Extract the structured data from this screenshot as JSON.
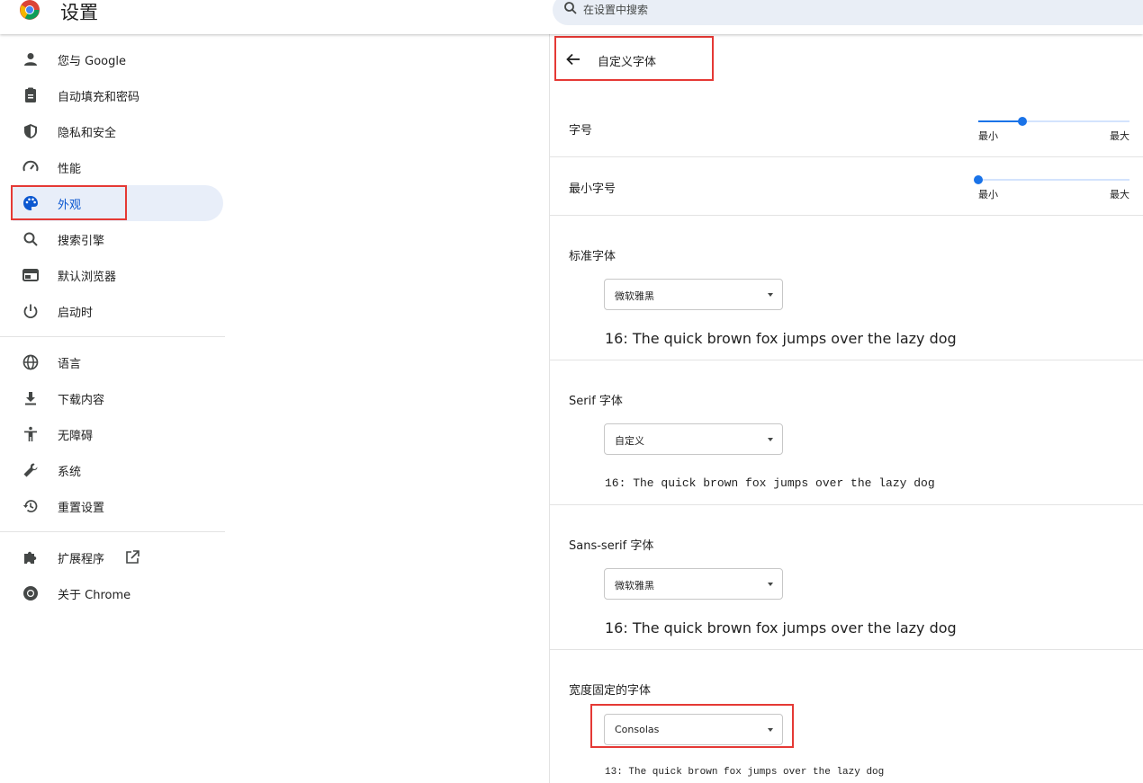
{
  "header": {
    "title": "设置",
    "search_placeholder": "在设置中搜索"
  },
  "sidebar": {
    "items": [
      {
        "label": "您与 Google",
        "icon": "person-icon"
      },
      {
        "label": "自动填充和密码",
        "icon": "clipboard-icon"
      },
      {
        "label": "隐私和安全",
        "icon": "shield-icon"
      },
      {
        "label": "性能",
        "icon": "speedometer-icon"
      },
      {
        "label": "外观",
        "icon": "palette-icon",
        "active": true
      },
      {
        "label": "搜索引擎",
        "icon": "search-icon"
      },
      {
        "label": "默认浏览器",
        "icon": "browser-icon"
      },
      {
        "label": "启动时",
        "icon": "power-icon"
      },
      {
        "label": "语言",
        "icon": "globe-icon"
      },
      {
        "label": "下载内容",
        "icon": "download-icon"
      },
      {
        "label": "无障碍",
        "icon": "accessibility-icon"
      },
      {
        "label": "系统",
        "icon": "wrench-icon"
      },
      {
        "label": "重置设置",
        "icon": "history-icon"
      },
      {
        "label": "扩展程序",
        "icon": "puzzle-icon"
      },
      {
        "label": "关于 Chrome",
        "icon": "chrome-icon"
      }
    ]
  },
  "panel": {
    "title": "自定义字体",
    "font_size": {
      "label": "字号",
      "min_label": "最小",
      "max_label": "最大",
      "value_fraction": 0.29
    },
    "min_font_size": {
      "label": "最小字号",
      "min_label": "最小",
      "max_label": "最大",
      "value_fraction": 0.0
    },
    "standard_font": {
      "label": "标准字体",
      "selected": "微软雅黑",
      "sample": "16: The quick brown fox jumps over the lazy dog"
    },
    "serif_font": {
      "label": "Serif 字体",
      "selected": "自定义",
      "sample": "16: The quick brown fox jumps over the lazy dog"
    },
    "sans_serif_font": {
      "label": "Sans-serif 字体",
      "selected": "微软雅黑",
      "sample": "16: The quick brown fox jumps over the lazy dog"
    },
    "fixed_width_font": {
      "label": "宽度固定的字体",
      "selected": "Consolas",
      "sample": "13: The quick brown fox jumps over the lazy dog"
    }
  },
  "colors": {
    "accent": "#1a73e8",
    "highlight": "#e53935",
    "active_bg": "#e8eef9"
  }
}
